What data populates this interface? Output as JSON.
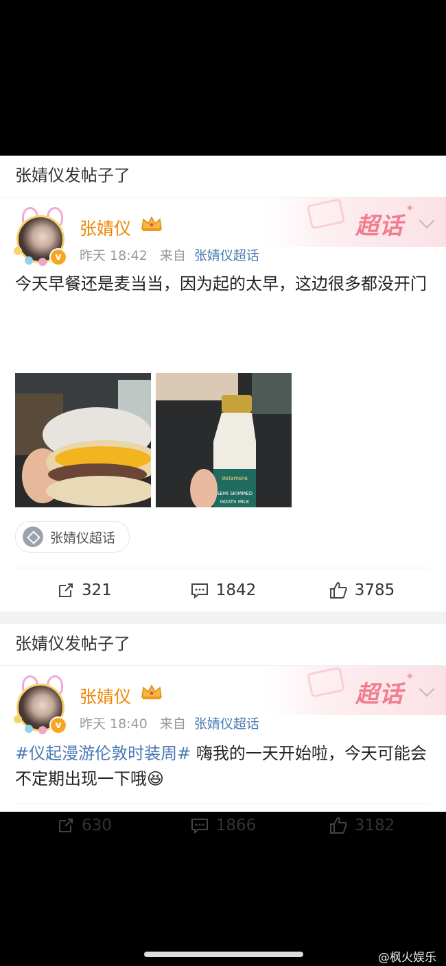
{
  "posts": [
    {
      "section_title": "张婧仪发帖子了",
      "author": "张婧仪",
      "time": "昨天 18:42",
      "from_label": "来自",
      "source": "张婧仪超话",
      "supertopic_badge": "超话",
      "text": "今天早餐还是麦当当，因为起的太早，这边很多都没开门",
      "topic_tag": "张婧仪超话",
      "reposts": "321",
      "comments": "1842",
      "likes": "3785"
    },
    {
      "section_title": "张婧仪发帖子了",
      "author": "张婧仪",
      "time": "昨天 18:40",
      "from_label": "来自",
      "source": "张婧仪超话",
      "supertopic_badge": "超话",
      "topic": "#仪起漫游伦敦时装周#",
      "text": " 嗨我的一天开始啦，今天可能会不定期出现一下哦",
      "emoji": "😆",
      "reposts": "630",
      "comments": "1866",
      "likes": "3182"
    }
  ],
  "bottle_label": {
    "brand": "delamere",
    "product": "SEMI SKIMMED",
    "line3": "GOATS MILK"
  },
  "watermark": "@枫火娱乐",
  "colors": {
    "name": "#f08300",
    "link": "#4a7ab5",
    "badge": "#f27d8f"
  }
}
